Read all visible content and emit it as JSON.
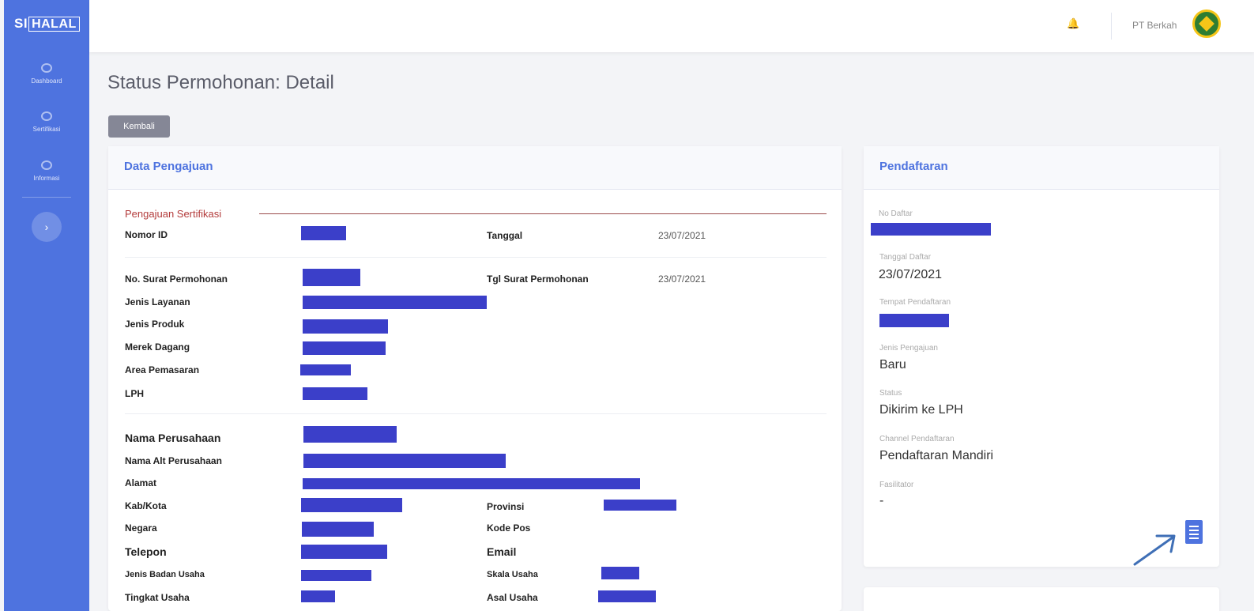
{
  "app": {
    "logo_prefix": "SI",
    "logo_box": "HALAL"
  },
  "sidebar": {
    "items": [
      {
        "label": "Dashboard",
        "icon": "dashboard-icon"
      },
      {
        "label": "Sertifikasi",
        "icon": "gear-icon"
      },
      {
        "label": "Informasi",
        "icon": "gear-icon"
      }
    ],
    "toggle": "›"
  },
  "topbar": {
    "bell": "🔔",
    "user_name": "PT Berkah",
    "accent": "#4e73df"
  },
  "page": {
    "title": "Status Permohonan: Detail",
    "back_label": "Kembali"
  },
  "left_card": {
    "header": "Data Pengajuan",
    "section_title": "Pengajuan Sertifikasi",
    "fields": {
      "nomor_id": "Nomor ID",
      "tanggal": "Tanggal",
      "tanggal_value": "23/07/2021",
      "no_surat": "No. Surat Permohonan",
      "tgl_surat": "Tgl Surat Permohonan",
      "tgl_surat_value": "23/07/2021",
      "jenis_layanan": "Jenis Layanan",
      "jenis_produk": "Jenis Produk",
      "merek_dagang": "Merek Dagang",
      "area_pemasaran": "Area Pemasaran",
      "lph": "LPH",
      "nama_perusahaan": "Nama Perusahaan",
      "nama_alt": "Nama Alt Perusahaan",
      "alamat": "Alamat",
      "kab_kota": "Kab/Kota",
      "provinsi": "Provinsi",
      "negara": "Negara",
      "kode_pos": "Kode Pos",
      "telepon": "Telepon",
      "email": "Email",
      "jenis_badan_usaha": "Jenis Badan Usaha",
      "skala_usaha": "Skala Usaha",
      "tingkat_usaha": "Tingkat Usaha",
      "asal_usaha": "Asal Usaha"
    }
  },
  "right_card": {
    "header": "Pendaftaran",
    "no_daftar_label": "No Daftar",
    "tanggal_daftar_label": "Tanggal Daftar",
    "tanggal_daftar_value": "23/07/2021",
    "tempat_label": "Tempat Pendaftaran",
    "jenis_pengajuan_label": "Jenis Pengajuan",
    "jenis_pengajuan_value": "Baru",
    "status_label": "Status",
    "status_value": "Dikirim ke LPH",
    "channel_label": "Channel Pendaftaran",
    "channel_value": "Pendaftaran Mandiri",
    "fasilitator_label": "Fasilitator",
    "fasilitator_value": "-"
  },
  "colors": {
    "redaction": "#3b3fc9",
    "sidebar": "#4e73df",
    "section_title": "#b33b3b"
  }
}
